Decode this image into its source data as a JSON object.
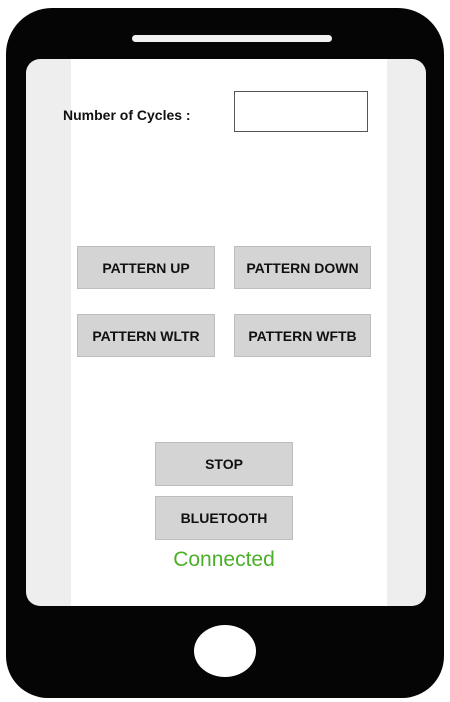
{
  "form": {
    "cycles_label": "Number of Cycles :",
    "cycles_value": ""
  },
  "buttons": {
    "pattern_up": "PATTERN UP",
    "pattern_down": "PATTERN DOWN",
    "pattern_wltr": "PATTERN WLTR",
    "pattern_wftb": "PATTERN WFTB",
    "stop": "STOP",
    "bluetooth": "BLUETOOTH"
  },
  "status": {
    "text": "Connected",
    "color": "#4caf2a"
  },
  "colors": {
    "phone_body": "#050505",
    "button_fill": "#d4d4d4"
  }
}
